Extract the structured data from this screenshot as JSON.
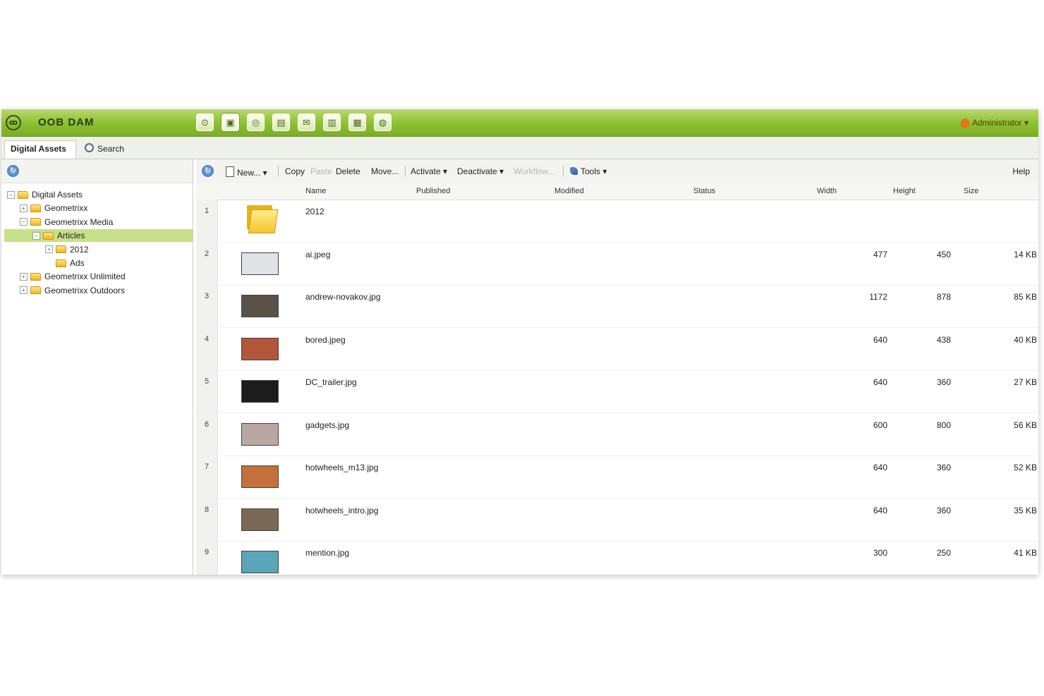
{
  "header": {
    "app_title": "OOB DAM",
    "user_label": "Administrator ▾",
    "modules": [
      {
        "icon": "home-icon",
        "glyph": "⊙"
      },
      {
        "icon": "assets-icon",
        "glyph": "▣"
      },
      {
        "icon": "search-module-icon",
        "glyph": "◎"
      },
      {
        "icon": "image-module-icon",
        "glyph": "▤"
      },
      {
        "icon": "mail-module-icon",
        "glyph": "✉"
      },
      {
        "icon": "document-module-icon",
        "glyph": "▥"
      },
      {
        "icon": "window-module-icon",
        "glyph": "▦"
      },
      {
        "icon": "globe-module-icon",
        "glyph": "◍"
      }
    ]
  },
  "tabs": {
    "assets": "Digital Assets",
    "search": "Search"
  },
  "tree": [
    {
      "label": "Digital Assets",
      "level": 0,
      "expander": "−"
    },
    {
      "label": "Geometrixx",
      "level": 1,
      "expander": "+"
    },
    {
      "label": "Geometrixx Media",
      "level": 1,
      "expander": "−"
    },
    {
      "label": "Articles",
      "level": 2,
      "expander": "−",
      "selected": true
    },
    {
      "label": "2012",
      "level": 3,
      "expander": "+"
    },
    {
      "label": "Ads",
      "level": 3,
      "expander": ""
    },
    {
      "label": "Geometrixx Unlimited",
      "level": 1,
      "expander": "+"
    },
    {
      "label": "Geometrixx Outdoors",
      "level": 1,
      "expander": "+"
    }
  ],
  "toolbar": {
    "new": "New... ▾",
    "copy": "Copy",
    "paste": "Paste",
    "delete": "Delete",
    "move": "Move...",
    "activate": "Activate ▾",
    "deactivate": "Deactivate ▾",
    "workflow": "Workflow...",
    "tools": "Tools ▾",
    "right_label": "Help"
  },
  "columns": {
    "name": "Name",
    "published": "Published",
    "modified": "Modified",
    "status": "Status",
    "width": "Width",
    "height": "Height",
    "size": "Size"
  },
  "rows": [
    {
      "n": "1",
      "name": "2012",
      "published": "",
      "modified": "",
      "width": "",
      "height": "",
      "size": "",
      "thumb": "folder"
    },
    {
      "n": "2",
      "name": "ai.jpeg",
      "published": "",
      "modified": "",
      "width": "477",
      "height": "450",
      "size": "14 KB",
      "thumb": "#dfe3e6"
    },
    {
      "n": "3",
      "name": "andrew-novakov.jpg",
      "published": "",
      "modified": "",
      "width": "1172",
      "height": "878",
      "size": "85 KB",
      "thumb": "#5a5246"
    },
    {
      "n": "4",
      "name": "bored.jpeg",
      "published": "",
      "modified": "",
      "width": "640",
      "height": "438",
      "size": "40 KB",
      "thumb": "#b1573a"
    },
    {
      "n": "5",
      "name": "DC_trailer.jpg",
      "published": "",
      "modified": "",
      "width": "640",
      "height": "360",
      "size": "27 KB",
      "thumb": "#1c1c1c"
    },
    {
      "n": "6",
      "name": "gadgets.jpg",
      "published": "",
      "modified": "",
      "width": "600",
      "height": "800",
      "size": "56 KB",
      "thumb": "#b9a7a3"
    },
    {
      "n": "7",
      "name": "hotwheels_m13.jpg",
      "published": "",
      "modified": "",
      "width": "640",
      "height": "360",
      "size": "52 KB",
      "thumb": "#c4703b"
    },
    {
      "n": "8",
      "name": "hotwheels_intro.jpg",
      "published": "",
      "modified": "",
      "width": "640",
      "height": "360",
      "size": "35 KB",
      "thumb": "#7a6a55"
    },
    {
      "n": "9",
      "name": "mention.jpg",
      "published": "",
      "modified": "",
      "width": "300",
      "height": "250",
      "size": "41 KB",
      "thumb": "#5aa6b8"
    }
  ]
}
